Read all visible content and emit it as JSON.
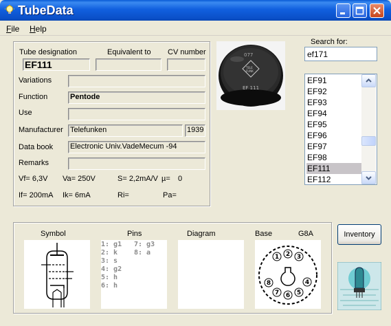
{
  "window": {
    "title": "TubeData"
  },
  "menu": [
    {
      "label": "File",
      "accel": "F",
      "rest": "ile"
    },
    {
      "label": "Help",
      "accel": "H",
      "rest": "elp"
    }
  ],
  "details": {
    "headers": {
      "designation": "Tube designation",
      "equivalent": "Equivalent to",
      "cv": "CV number"
    },
    "designation": "EF111",
    "equivalent": "",
    "cv": "",
    "labels": {
      "variations": "Variations",
      "function": "Function",
      "use": "Use",
      "manufacturer": "Manufacturer",
      "databook": "Data book",
      "remarks": "Remarks"
    },
    "variations": "",
    "function": "Pentode",
    "use": "",
    "manufacturer": "Telefunken",
    "year": "1939",
    "databook": "Electronic Univ.VadeMecum -94",
    "remarks": "",
    "params_row1": {
      "vf": "Vf= 6,3V",
      "va": "Va= 250V",
      "s": "S= 2,2mA/V",
      "mu": "µ=",
      "mu_val": "0"
    },
    "params_row2": {
      "if": "If= 200mA",
      "ik": "Ik= 6mA",
      "ri": "Ri=",
      "pa": "Pa="
    }
  },
  "search": {
    "label": "Search for:",
    "value": "ef171",
    "items": [
      "EF91",
      "EF92",
      "EF93",
      "EF94",
      "EF95",
      "EF96",
      "EF97",
      "EF98",
      "EF111",
      "EF112"
    ],
    "selected": "EF111"
  },
  "bottom": {
    "symbol_label": "Symbol",
    "pins_label": "Pins",
    "diagram_label": "Diagram",
    "base_label": "Base",
    "base_type": "G8A",
    "pins_col1": "1: g1\n2: k\n3: s\n4: g2\n5: h\n6: h",
    "pins_col2": "7: g3\n8: a",
    "inventory_label": "Inventory"
  }
}
